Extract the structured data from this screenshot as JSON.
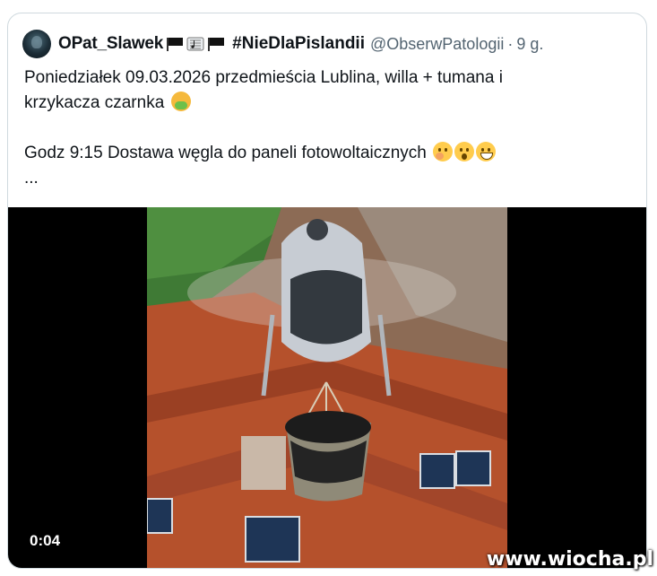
{
  "tweet": {
    "author": {
      "display_name": "OPat_Slawek",
      "hashtag": "#NieDlaPislandii",
      "handle": "@ObserwPatologii",
      "separator": "·",
      "time": "9 g."
    },
    "text_line1": "Poniedziałek 09.03.2026 przedmieścia Lublina, willa + tumana i",
    "text_line2": "krzykacza czarnka",
    "text_line3": "Godz 9:15 Dostawa węgla do paneli  fotowoltaicznych",
    "text_more": "...",
    "emoji": [
      "face-vomiting-emoji",
      "face-with-hand-over-mouth-emoji",
      "hushed-face-emoji",
      "grinning-face-emoji"
    ]
  },
  "video": {
    "duration": "0:04",
    "scene_colors": {
      "grass": "#3f7a35",
      "roof": "#b5512c",
      "helicopter": "#c7ccd3",
      "coal": "#1c1c1c"
    }
  },
  "watermark": "www.wiocha.pl"
}
